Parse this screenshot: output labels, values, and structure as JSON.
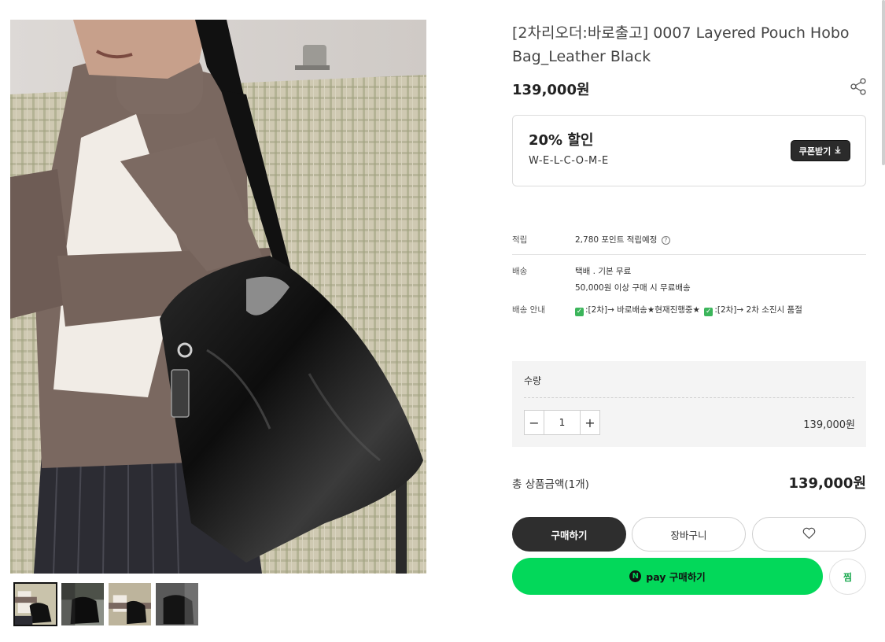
{
  "product": {
    "title": "[2차리오더:바로출고] 0007 Layered Pouch Hobo Bag_Leather Black",
    "price": "139,000원",
    "share_icon": "share-icon"
  },
  "gallery": {
    "main_image_alt": "model wearing black leather hobo bag",
    "thumbnails": [
      {
        "alt": "thumbnail 1"
      },
      {
        "alt": "thumbnail 2"
      },
      {
        "alt": "thumbnail 3"
      },
      {
        "alt": "thumbnail 4"
      }
    ],
    "active_index": 0
  },
  "coupon": {
    "rate": "20% 할인",
    "code": "W-E-L-C-O-M-E",
    "button_label": "쿠폰받기",
    "button_icon": "download-icon"
  },
  "details": {
    "points_label": "적립",
    "points_value": "2,780 포인트 적립예정",
    "shipping_label": "배송",
    "shipping_value": "택배 . 기본 무료",
    "shipping_free": "50,000원 이상 구매 시 무료배송",
    "notice_label": "배송 안내",
    "notice_1": ":[2차]→ 바로배송★현재진행중★",
    "notice_2": ":[2차]→ 2차 소진시 품절"
  },
  "quantity": {
    "label": "수량",
    "value": "1",
    "minus": "−",
    "plus": "+",
    "line_price": "139,000원"
  },
  "total": {
    "label": "총 상품금액(1개)",
    "value": "139,000원"
  },
  "actions": {
    "buy_label": "구매하기",
    "cart_label": "장바구니",
    "wish_icon": "heart-icon",
    "npay_logo": "N",
    "npay_text": "pay 구매하기",
    "jjim_label": "찜"
  },
  "colors": {
    "primary_dark": "#2e2e2e",
    "npay_green": "#03d85a",
    "check_green": "#3cb55b"
  }
}
